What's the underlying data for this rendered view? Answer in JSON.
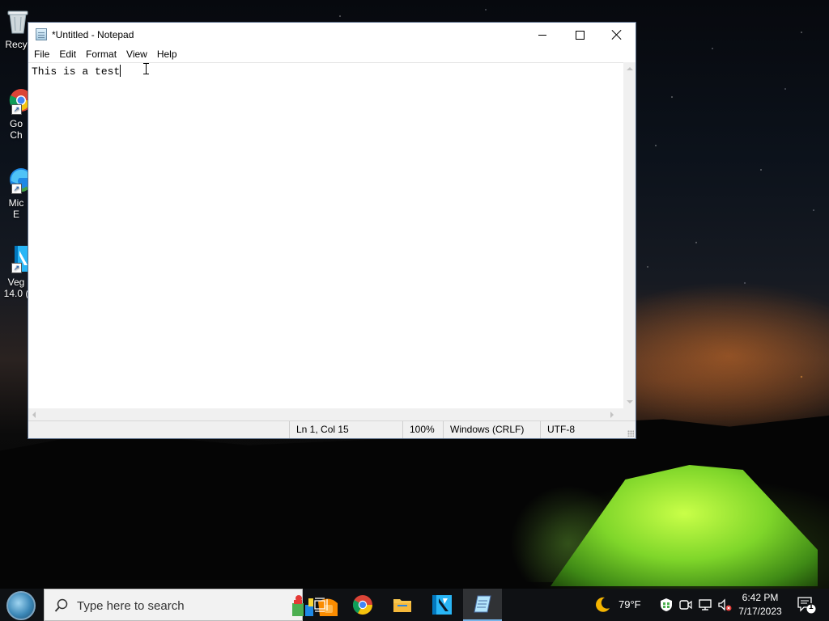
{
  "desktop": {
    "icons": [
      {
        "label": "Recy"
      },
      {
        "label": "Go\nCh"
      },
      {
        "label": "Mic\nE"
      },
      {
        "label": "Veg\n14.0 ("
      }
    ]
  },
  "notepad": {
    "title": "*Untitled - Notepad",
    "menu": [
      "File",
      "Edit",
      "Format",
      "View",
      "Help"
    ],
    "content": "This is a test",
    "status": {
      "position": "Ln 1, Col 15",
      "zoom": "100%",
      "line_ending": "Windows (CRLF)",
      "encoding": "UTF-8"
    }
  },
  "taskbar": {
    "search_placeholder": "Type here to search",
    "weather": "79°F",
    "time": "6:42 PM",
    "date": "7/17/2023",
    "notification_count": "1",
    "pinned": [
      "task-view",
      "chrome",
      "file-explorer",
      "vegas",
      "notepad"
    ],
    "accent_color": "#78b4e8"
  }
}
